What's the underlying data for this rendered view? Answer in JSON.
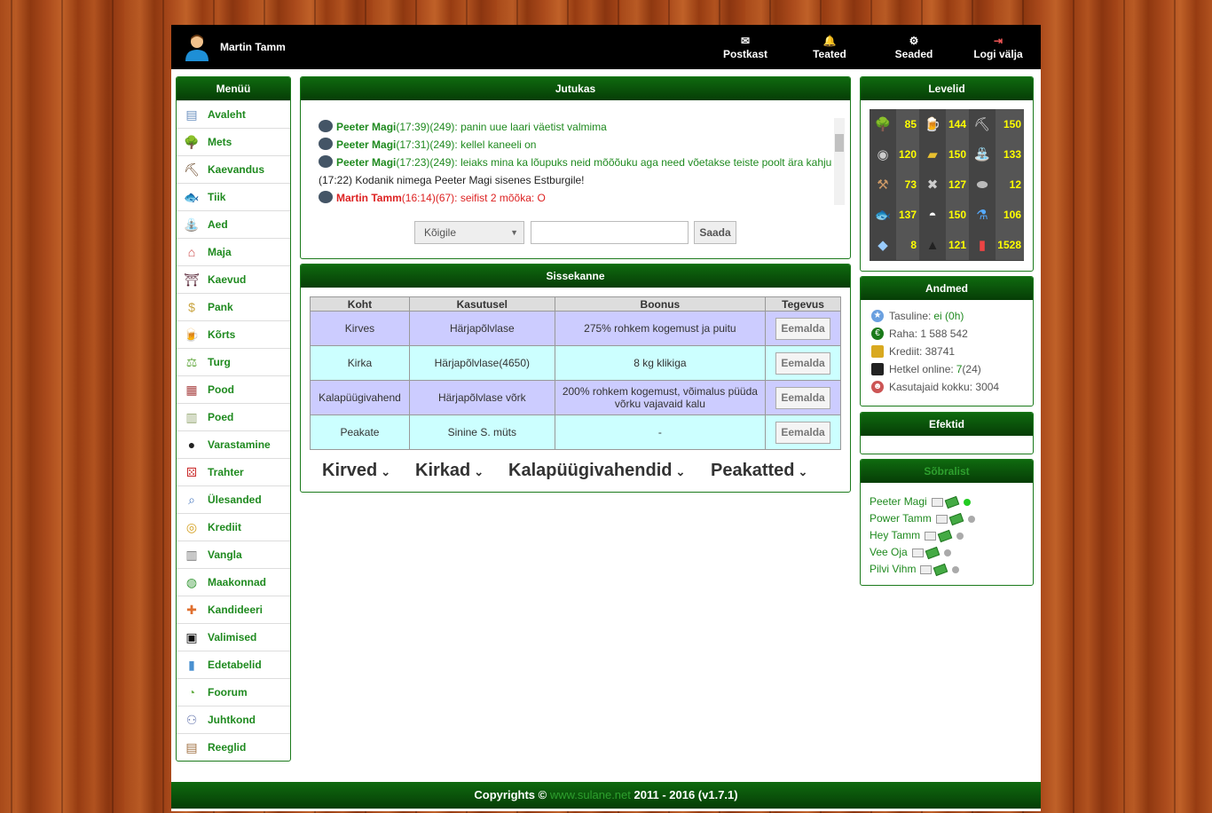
{
  "topbar": {
    "username": "Martin Tamm",
    "nav": [
      {
        "label": "Postkast",
        "icon": "mail-icon"
      },
      {
        "label": "Teated",
        "icon": "bell-icon"
      },
      {
        "label": "Seaded",
        "icon": "gear-icon"
      },
      {
        "label": "Logi välja",
        "icon": "logout-icon"
      }
    ]
  },
  "menu": {
    "title": "Menüü",
    "items": [
      {
        "label": "Avaleht",
        "icon": "news-icon"
      },
      {
        "label": "Mets",
        "icon": "tree-icon"
      },
      {
        "label": "Kaevandus",
        "icon": "pickaxe-icon"
      },
      {
        "label": "Tiik",
        "icon": "fish-icon"
      },
      {
        "label": "Aed",
        "icon": "watering-can-icon"
      },
      {
        "label": "Maja",
        "icon": "house-icon"
      },
      {
        "label": "Kaevud",
        "icon": "well-icon"
      },
      {
        "label": "Pank",
        "icon": "money-icon"
      },
      {
        "label": "Kõrts",
        "icon": "beer-icon"
      },
      {
        "label": "Turg",
        "icon": "market-icon"
      },
      {
        "label": "Pood",
        "icon": "shop-icon"
      },
      {
        "label": "Poed",
        "icon": "shops-icon"
      },
      {
        "label": "Varastamine",
        "icon": "thief-icon"
      },
      {
        "label": "Trahter",
        "icon": "dice-icon"
      },
      {
        "label": "Ülesanded",
        "icon": "magnifier-icon"
      },
      {
        "label": "Krediit",
        "icon": "coins-icon"
      },
      {
        "label": "Vangla",
        "icon": "jail-icon"
      },
      {
        "label": "Maakonnad",
        "icon": "globe-icon"
      },
      {
        "label": "Kandideeri",
        "icon": "apply-icon"
      },
      {
        "label": "Valimised",
        "icon": "ballot-box-icon"
      },
      {
        "label": "Edetabelid",
        "icon": "bar-chart-icon"
      },
      {
        "label": "Foorum",
        "icon": "chat-bubble-icon"
      },
      {
        "label": "Juhtkond",
        "icon": "people-icon"
      },
      {
        "label": "Reeglid",
        "icon": "clipboard-icon"
      }
    ]
  },
  "chat": {
    "title": "Jutukas",
    "messages": [
      {
        "who": "Peeter Magi",
        "meta": "(17:39)(249): ",
        "text": "panin uue laari väetist valmima",
        "type": "user"
      },
      {
        "who": "Peeter Magi",
        "meta": "(17:31)(249): ",
        "text": "kellel kaneeli on",
        "type": "user"
      },
      {
        "who": "Peeter Magi",
        "meta": "(17:23)(249): ",
        "text": "leiaks mina ka lõupuks neid mõõõuku aga need võetakse teiste poolt ära kahju",
        "type": "user"
      },
      {
        "who": "",
        "meta": "(17:22) ",
        "text": "Kodanik nimega Peeter Magi sisenes Estburgile!",
        "type": "sys"
      },
      {
        "who": "Martin Tamm",
        "meta": "(16:14)(67): ",
        "text": "seifist 2 mõõka: O",
        "type": "red"
      }
    ],
    "target_select": "Kõigile",
    "input_value": "",
    "send_label": "Saada"
  },
  "entry": {
    "title": "Sissekanne",
    "headers": [
      "Koht",
      "Kasutusel",
      "Boonus",
      "Tegevus"
    ],
    "rows": [
      {
        "slot": "Kirves",
        "item": "Härjapõlvlase",
        "bonus": "275% rohkem kogemust ja puitu",
        "action": "Eemalda"
      },
      {
        "slot": "Kirka",
        "item": "Härjapõlvlase(4650)",
        "bonus": "8 kg klikiga",
        "action": "Eemalda"
      },
      {
        "slot": "Kalapüügivahend",
        "item": "Härjapõlvlase võrk",
        "bonus": "200% rohkem kogemust, võimalus püüda võrku vajavaid kalu",
        "action": "Eemalda"
      },
      {
        "slot": "Peakate",
        "item": "Sinine S. müts",
        "bonus": "-",
        "action": "Eemalda"
      }
    ],
    "categories": [
      "Kirved",
      "Kirkad",
      "Kalapüügivahendid",
      "Peakatted"
    ]
  },
  "levels": {
    "title": "Levelid",
    "items": [
      {
        "icon": "tree-icon",
        "value": "85"
      },
      {
        "icon": "beer-icon",
        "value": "144"
      },
      {
        "icon": "pickaxe-icon",
        "value": "150"
      },
      {
        "icon": "mask-icon",
        "value": "120"
      },
      {
        "icon": "gold-bar-icon",
        "value": "150"
      },
      {
        "icon": "watering-can-icon",
        "value": "133"
      },
      {
        "icon": "hammer-icon",
        "value": "73"
      },
      {
        "icon": "crossed-tools-icon",
        "value": "127"
      },
      {
        "icon": "anvil-icon",
        "value": "12"
      },
      {
        "icon": "fish-icon",
        "value": "137"
      },
      {
        "icon": "chef-hat-icon",
        "value": "150"
      },
      {
        "icon": "flask-icon",
        "value": "106"
      },
      {
        "icon": "diamond-icon",
        "value": "8"
      },
      {
        "icon": "wizard-hat-icon",
        "value": "121"
      },
      {
        "icon": "bar-chart-icon",
        "value": "1528"
      }
    ]
  },
  "data": {
    "title": "Andmed",
    "tasuline_label": "Tasuline: ",
    "tasuline_value": "ei (0h)",
    "raha": "Raha: 1 588 542",
    "krediit": "Krediit: 38741",
    "online_label": "Hetkel online: ",
    "online_value": "7",
    "online_extra": " (24)",
    "users": "Kasutajaid kokku: 3004"
  },
  "effects": {
    "title": "Efektid"
  },
  "friends": {
    "title": "Sõbralist",
    "items": [
      {
        "name": "Peeter Magi",
        "online": true
      },
      {
        "name": "Power Tamm",
        "online": false
      },
      {
        "name": "Hey Tamm",
        "online": false
      },
      {
        "name": "Vee Oja",
        "online": false
      },
      {
        "name": "Pilvi Vihm",
        "online": false
      }
    ]
  },
  "footer": {
    "prefix": "Copyrights © ",
    "site": "www.sulane.net",
    "suffix": " 2011 - 2016 (v1.7.1)"
  },
  "colors": {
    "accent_green": "#1f8a1f",
    "header_green": "#0f6a0f",
    "row_odd": "#ccccff",
    "row_even": "#ccffff"
  }
}
